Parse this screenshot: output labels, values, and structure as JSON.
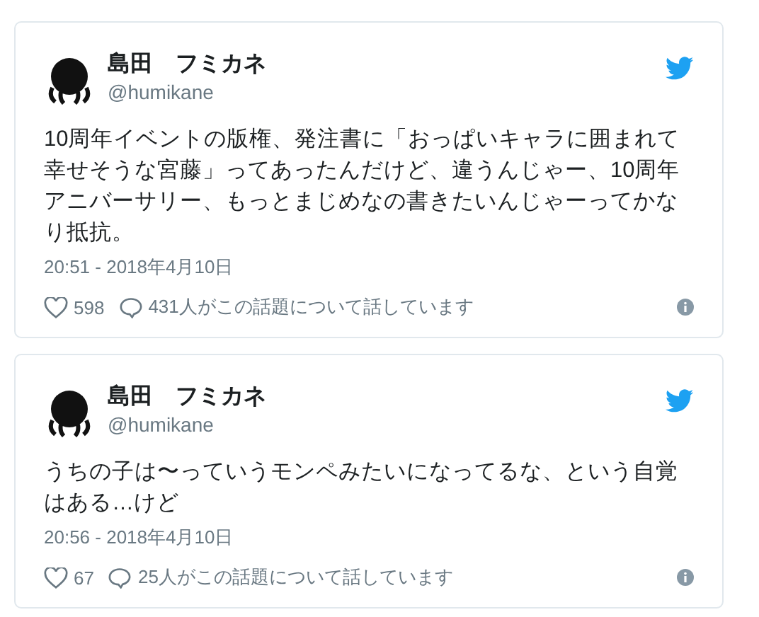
{
  "tweets": [
    {
      "name": "島田　フミカネ",
      "handle": "@humikane",
      "text": "10周年イベントの版権、発注書に「おっぱいキャラに囲まれて幸せそうな宮藤」ってあったんだけど、違うんじゃー、10周年アニバーサリー、もっとまじめなの書きたいんじゃーってかなり抵抗。",
      "date": "20:51 - 2018年4月10日",
      "likes": "598",
      "replies": "431人がこの話題について話しています"
    },
    {
      "name": "島田　フミカネ",
      "handle": "@humikane",
      "text": "うちの子は〜っていうモンペみたいになってるな、という自覚はある…けど",
      "date": "20:56 - 2018年4月10日",
      "likes": "67",
      "replies": "25人がこの話題について話しています"
    }
  ]
}
